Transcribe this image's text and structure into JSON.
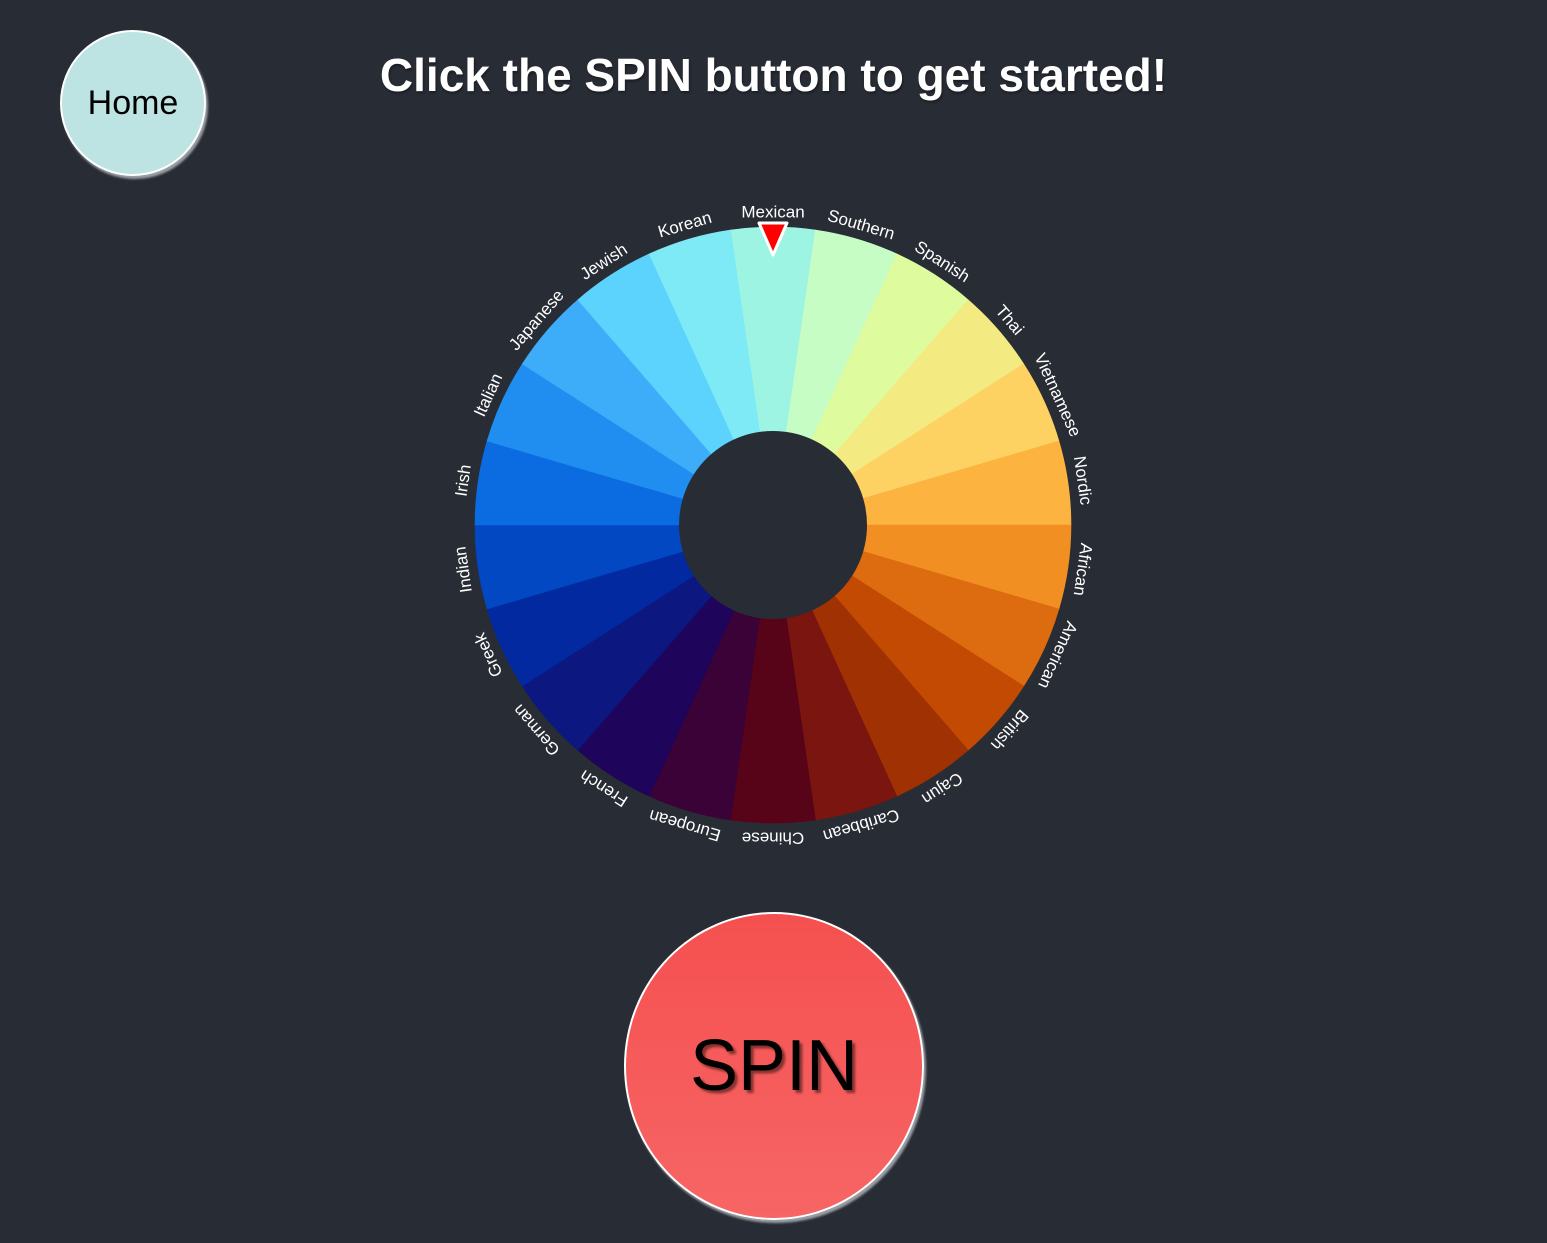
{
  "header": {
    "home_label": "Home",
    "title": "Click the SPIN button to get started!"
  },
  "wheel": {
    "selected": "Mexican",
    "pointer_color": "#ff0000",
    "segments": [
      {
        "label": "Mexican",
        "color": "#9ef4e2"
      },
      {
        "label": "Southern",
        "color": "#c6fdc4"
      },
      {
        "label": "Spanish",
        "color": "#defb9e"
      },
      {
        "label": "Thai",
        "color": "#f3ea82"
      },
      {
        "label": "Vietnamese",
        "color": "#fdd262"
      },
      {
        "label": "Nordic",
        "color": "#fdb33f"
      },
      {
        "label": "African",
        "color": "#f28f23"
      },
      {
        "label": "American",
        "color": "#dd6c10"
      },
      {
        "label": "British",
        "color": "#c34a03"
      },
      {
        "label": "Cajun",
        "color": "#a03102"
      },
      {
        "label": "Caribbean",
        "color": "#7a1510"
      },
      {
        "label": "Chinese",
        "color": "#570419"
      },
      {
        "label": "European",
        "color": "#3a0236"
      },
      {
        "label": "French",
        "color": "#1e045b"
      },
      {
        "label": "German",
        "color": "#0c1780"
      },
      {
        "label": "Greek",
        "color": "#0229a0"
      },
      {
        "label": "Indian",
        "color": "#0148c2"
      },
      {
        "label": "Irish",
        "color": "#0a6ce0"
      },
      {
        "label": "Italian",
        "color": "#208ef0"
      },
      {
        "label": "Japanese",
        "color": "#3dadfa"
      },
      {
        "label": "Jewish",
        "color": "#5bd3fd"
      },
      {
        "label": "Korean",
        "color": "#7eeaf5"
      }
    ]
  },
  "spin": {
    "label": "SPIN"
  },
  "colors": {
    "background": "#282c34",
    "home_button": "#bee3e3",
    "spin_button": "#f55050"
  }
}
